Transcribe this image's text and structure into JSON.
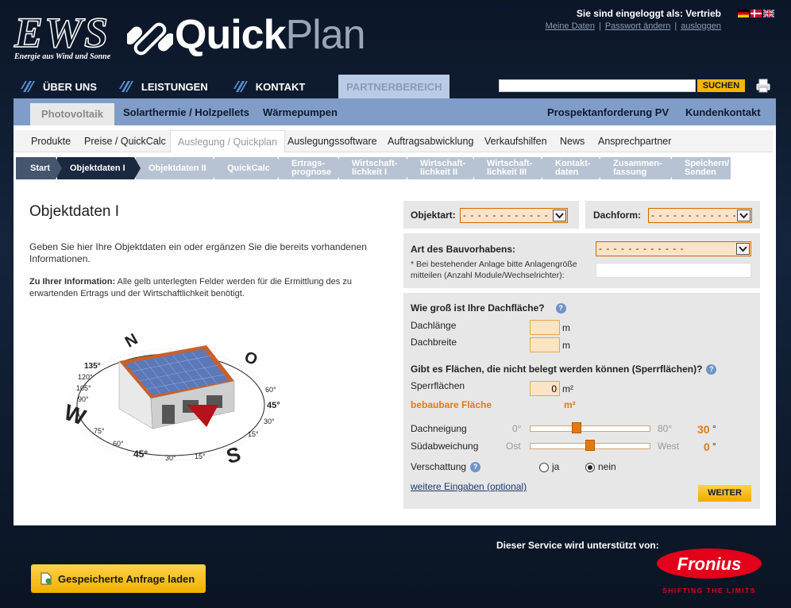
{
  "header": {
    "ews_logo": "EWS",
    "ews_tagline": "Energie aus Wind und Sonne",
    "quickplan_logo_1": "Quick",
    "quickplan_logo_2": "Plan",
    "login_text": "Sie sind eingeloggt als:",
    "login_user": "Vertrieb",
    "account_links": [
      "Meine Daten",
      "Passwort ändern",
      "ausloggen"
    ],
    "search_button": "SUCHEN",
    "search_value": ""
  },
  "top_nav": [
    "ÜBER UNS",
    "LEISTUNGEN",
    "KONTAKT",
    "PARTNERBEREICH"
  ],
  "sub_nav": {
    "left": [
      "Photovoltaik",
      "Solarthermie / Holzpellets",
      "Wärmepumpen"
    ],
    "right": [
      "Prospektanforderung PV",
      "Kundenkontakt"
    ]
  },
  "third_nav": [
    "Produkte",
    "Preise / QuickCalc",
    "Auslegung / Quickplan",
    "Auslegungssoftware",
    "Auftragsabwicklung",
    "Verkaufshilfen",
    "News",
    "Ansprechpartner"
  ],
  "steps": [
    {
      "l1": "Start",
      "l2": ""
    },
    {
      "l1": "Objektdaten I",
      "l2": ""
    },
    {
      "l1": "Objektdaten II",
      "l2": ""
    },
    {
      "l1": "QuickCalc",
      "l2": ""
    },
    {
      "l1": "Ertrags-",
      "l2": "prognose"
    },
    {
      "l1": "Wirtschaft-",
      "l2": "lichkeit I"
    },
    {
      "l1": "Wirtschaft-",
      "l2": "lichkeit II"
    },
    {
      "l1": "Wirtschaft-",
      "l2": "lichkeit III"
    },
    {
      "l1": "Kontakt-",
      "l2": "daten"
    },
    {
      "l1": "Zusammen-",
      "l2": "fassung"
    },
    {
      "l1": "Speichern/",
      "l2": "Senden"
    }
  ],
  "main": {
    "title": "Objektdaten I",
    "intro": "Geben Sie hier Ihre Objektdaten ein oder ergänzen Sie die bereits vorhandenen Informationen.",
    "info_bold": "Zu Ihrer Information:",
    "info_text": " Alle gelb unterlegten Felder werden für die Ermittlung des zu erwartenden Ertrags und der Wirtschaftlichkeit benötigt.",
    "compass": {
      "n": "N",
      "o": "O",
      "s": "S",
      "w": "W",
      "deg": [
        "45°",
        "30°",
        "15°",
        "15°",
        "30°",
        "45°",
        "60°",
        "75°",
        "90°",
        "105°",
        "120°",
        "135°",
        "60°",
        "75°",
        "90°",
        "105°",
        "120°",
        "135°",
        "45°",
        "60°"
      ]
    }
  },
  "form": {
    "objektart_label": "Objektart:",
    "objektart_value": "- - - - - - - - - - - -",
    "dachform_label": "Dachform:",
    "dachform_value": "- - - - - - - - - - - -",
    "bauvorhaben_label": "Art des Bauvorhabens:",
    "bauvorhaben_value": "- - - - - - - - - - - -",
    "bauvorhaben_note": "* Bei bestehender Anlage bitte Anlagengröße mitteilen (Anzahl Module/Wechselrichter):",
    "bauvorhaben_note_value": "",
    "dachflaeche_q": "Wie groß ist Ihre Dachfläche?",
    "dachlaenge_label": "Dachlänge",
    "dachlaenge_value": "",
    "dachbreite_label": "Dachbreite",
    "dachbreite_value": "",
    "unit_m": "m",
    "sperr_q": "Gibt es Flächen, die nicht belegt werden können (Sperrflächen)?",
    "sperr_label": "Sperrflächen",
    "sperr_value": "0",
    "unit_m2": "m²",
    "bebaubar_label": "bebaubare Fläche",
    "bebaubar_unit": "m²",
    "neigung_label": "Dachneigung",
    "neigung_min": "0°",
    "neigung_max": "80°",
    "neigung_value": "30",
    "neigung_fraction": 0.375,
    "sued_label": "Südabweichung",
    "sued_min": "Ost",
    "sued_max": "West",
    "sued_value": "0",
    "sued_fraction": 0.5,
    "deg_unit": "°",
    "verschattung_label": "Verschattung",
    "ja": "ja",
    "nein": "nein",
    "weitere": "weitere Eingaben (optional)",
    "weiter_button": "WEITER"
  },
  "footer": {
    "support": "Dieser Service wird unterstützt von:",
    "fronius": "Fronius",
    "fronius_tagline": "SHIFTING THE LIMITS",
    "load_button": "Gespeicherte Anfrage laden"
  }
}
